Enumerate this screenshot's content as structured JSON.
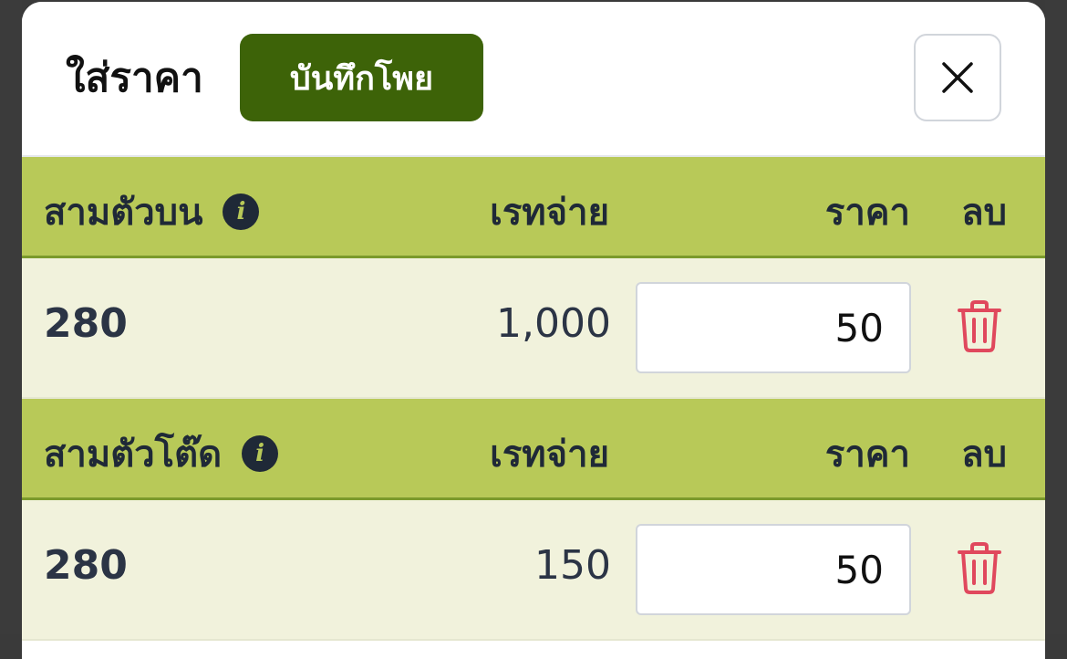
{
  "modal": {
    "title": "ใส่ราคา",
    "save_label": "บันทึกโพย"
  },
  "columns": {
    "rate": "เรทจ่าย",
    "price": "ราคา",
    "delete": "ลบ"
  },
  "sections": [
    {
      "title": "สามตัวบน",
      "rows": [
        {
          "number": "280",
          "rate": "1,000",
          "price": "50"
        }
      ]
    },
    {
      "title": "สามตัวโต๊ด",
      "rows": [
        {
          "number": "280",
          "rate": "150",
          "price": "50"
        }
      ]
    }
  ],
  "icons": {
    "info": "info-icon",
    "close": "close-icon",
    "delete": "trash-icon"
  },
  "colors": {
    "save_button": "#3d6308",
    "section_header": "#b8c958",
    "row_background": "#f1f2dc",
    "delete_icon": "#e0485d"
  }
}
